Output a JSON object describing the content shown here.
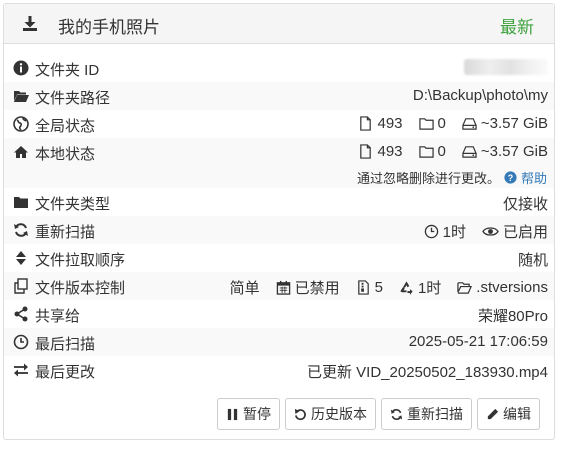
{
  "header": {
    "title": "我的手机照片",
    "status": "最新"
  },
  "rows": {
    "folder_id": {
      "label": "文件夹 ID"
    },
    "folder_path": {
      "label": "文件夹路径",
      "value": "D:\\Backup\\photo\\my"
    },
    "global_state": {
      "label": "全局状态",
      "files": "493",
      "folders": "0",
      "size": "~3.57 GiB"
    },
    "local_state": {
      "label": "本地状态",
      "files": "493",
      "folders": "0",
      "size": "~3.57 GiB"
    },
    "ignore_note": {
      "text": "通过忽略删除进行更改。",
      "help": "帮助"
    },
    "folder_type": {
      "label": "文件夹类型",
      "value": "仅接收"
    },
    "rescan": {
      "label": "重新扫描",
      "interval": "1时",
      "watcher": "已启用"
    },
    "pull_order": {
      "label": "文件拉取顺序",
      "value": "随机"
    },
    "versioning": {
      "label": "文件版本控制",
      "type": "简单",
      "cleanup": "已禁用",
      "keep": "5",
      "interval": "1时",
      "path": ".stversions"
    },
    "shared_with": {
      "label": "共享给",
      "value": "荣耀80Pro"
    },
    "last_scan": {
      "label": "最后扫描",
      "value": "2025-05-21 17:06:59"
    },
    "last_change": {
      "label": "最后更改",
      "value": "已更新 VID_20250502_183930.mp4"
    }
  },
  "buttons": {
    "pause": "暂停",
    "versions": "历史版本",
    "rescan": "重新扫描",
    "edit": "编辑"
  }
}
